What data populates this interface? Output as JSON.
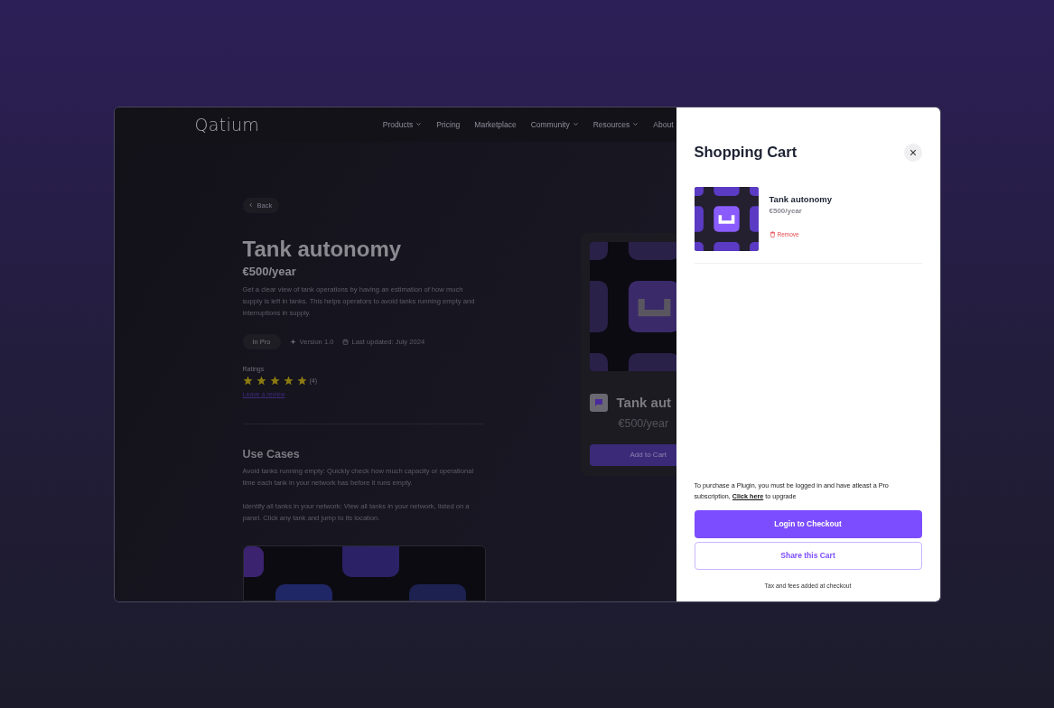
{
  "site": {
    "logo": "Qatium",
    "nav": [
      {
        "label": "Products",
        "has_menu": true
      },
      {
        "label": "Pricing",
        "has_menu": false
      },
      {
        "label": "Marketplace",
        "has_menu": false
      },
      {
        "label": "Community",
        "has_menu": true
      },
      {
        "label": "Resources",
        "has_menu": true
      },
      {
        "label": "About",
        "has_menu": false
      }
    ],
    "back": "Back",
    "title": "Tank autonomy",
    "price": "€500/year",
    "description": "Get a clear view of tank operations by having an estimation of how much supply is left in tanks. This helps operators to avoid tanks running empty and interruptions in supply.",
    "tag": "In Pro",
    "version": "Version 1.0",
    "updated": "Last updated: July 2024",
    "ratings_label": "Ratings",
    "stars": 5,
    "rating_count": "(4)",
    "review_link": "Leave a review",
    "use_cases_title": "Use Cases",
    "use_cases": [
      "Avoid tanks running empty: Quickly check how much capacity or operational time each tank in your network has before it runs empty.",
      "Identify all tanks in your network: View all tanks in your network, listed on a panel. Click any tank and jump to its location."
    ],
    "card": {
      "title": "Tank aut",
      "price": "€500/year",
      "button": "Add to Cart"
    }
  },
  "cart": {
    "title": "Shopping Cart",
    "items": [
      {
        "name": "Tank autonomy",
        "price": "€500/year",
        "remove": "Remove"
      }
    ],
    "notice_before": "To purchase a Plugin, you must be logged in and have atleast a Pro subscription, ",
    "notice_link": "Click here",
    "notice_after": " to upgrade",
    "primary_button": "Login to Checkout",
    "secondary_button": "Share this Cart",
    "footnote": "Tax and fees added at checkout"
  }
}
